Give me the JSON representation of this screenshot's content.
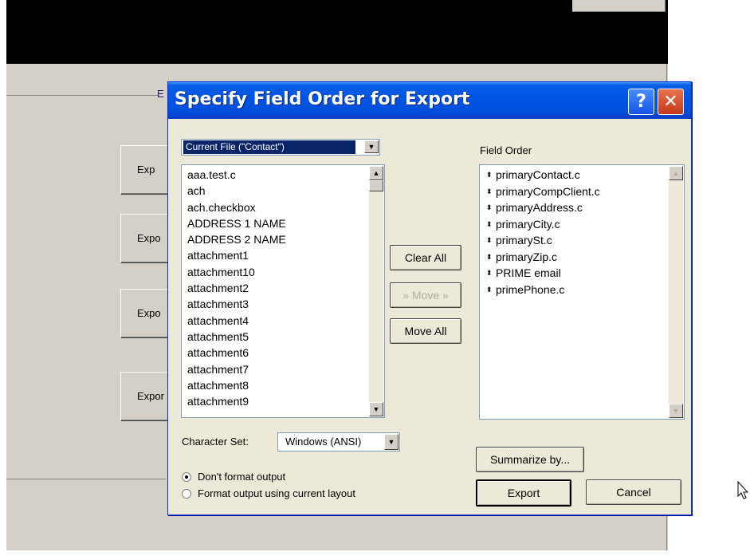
{
  "background": {
    "heading_fragment": "E",
    "button_labels": [
      "Exp",
      "Expo",
      "Expo",
      "Expor"
    ]
  },
  "dialog": {
    "title": "Specify Field Order for Export",
    "help_label": "?",
    "close_label": "✕",
    "file_select": "Current File (\"Contact\")",
    "available_fields": [
      "aaa.test.c",
      "ach",
      "ach.checkbox",
      "ADDRESS 1 NAME",
      "ADDRESS 2 NAME",
      "attachment1",
      "attachment10",
      "attachment2",
      "attachment3",
      "attachment4",
      "attachment5",
      "attachment6",
      "attachment7",
      "attachment8",
      "attachment9"
    ],
    "buttons": {
      "clear_all": "Clear All",
      "move": "» Move »",
      "move_all": "Move All",
      "summarize": "Summarize by...",
      "export": "Export",
      "cancel": "Cancel"
    },
    "field_order_label": "Field Order",
    "field_order": [
      "primaryContact.c",
      "primaryCompClient.c",
      "primaryAddress.c",
      "primaryCity.c",
      "primarySt.c",
      "primaryZip.c",
      "PRIME email",
      "primePhone.c"
    ],
    "charset_label": "Character Set:",
    "charset_value": "Windows (ANSI)",
    "radio_options": [
      {
        "label": "Don't format output",
        "checked": true
      },
      {
        "label": "Format output using current layout",
        "checked": false
      }
    ]
  },
  "icons": {
    "dropdown_arrow": "▼",
    "scroll_up": "▲",
    "scroll_down": "▼",
    "drag_grip": "⬍"
  },
  "colors": {
    "titlebar": "#0054e3",
    "dialog_face": "#ece9d8",
    "selection": "#0a246a",
    "close_button": "#c4391a"
  }
}
